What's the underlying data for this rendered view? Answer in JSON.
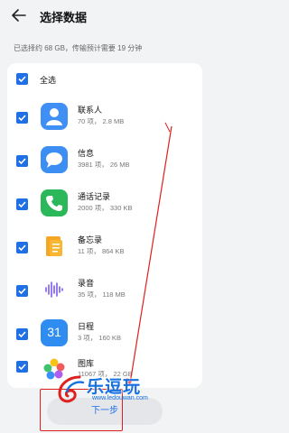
{
  "header": {
    "title": "选择数据"
  },
  "summary": "已选择约 68 GB，传输预计需要 19 分钟",
  "select_all": {
    "label": "全选",
    "checked": true
  },
  "items": [
    {
      "name": "联系人",
      "meta": "70 项， 2.8 MB",
      "icon": "contacts-icon",
      "checked": true
    },
    {
      "name": "信息",
      "meta": "3981 项， 26 MB",
      "icon": "messages-icon",
      "checked": true
    },
    {
      "name": "通话记录",
      "meta": "2000 项， 330 KB",
      "icon": "call-log-icon",
      "checked": true
    },
    {
      "name": "备忘录",
      "meta": "11 项， 864 KB",
      "icon": "notes-icon",
      "checked": true
    },
    {
      "name": "录音",
      "meta": "35 项， 118 MB",
      "icon": "recorder-icon",
      "checked": true
    },
    {
      "name": "日程",
      "meta": "3 项， 160 KB",
      "icon": "calendar-icon",
      "calendar_day": "31",
      "checked": true
    },
    {
      "name": "图库",
      "meta": "11067 项， 22 GB",
      "icon": "gallery-icon",
      "checked": true
    }
  ],
  "next_button": "下一步",
  "watermark": {
    "text": "乐逗玩",
    "url": "www.ledouwan.com"
  },
  "colors": {
    "accent": "#1f6fe5",
    "annotation": "#e01f1f"
  }
}
